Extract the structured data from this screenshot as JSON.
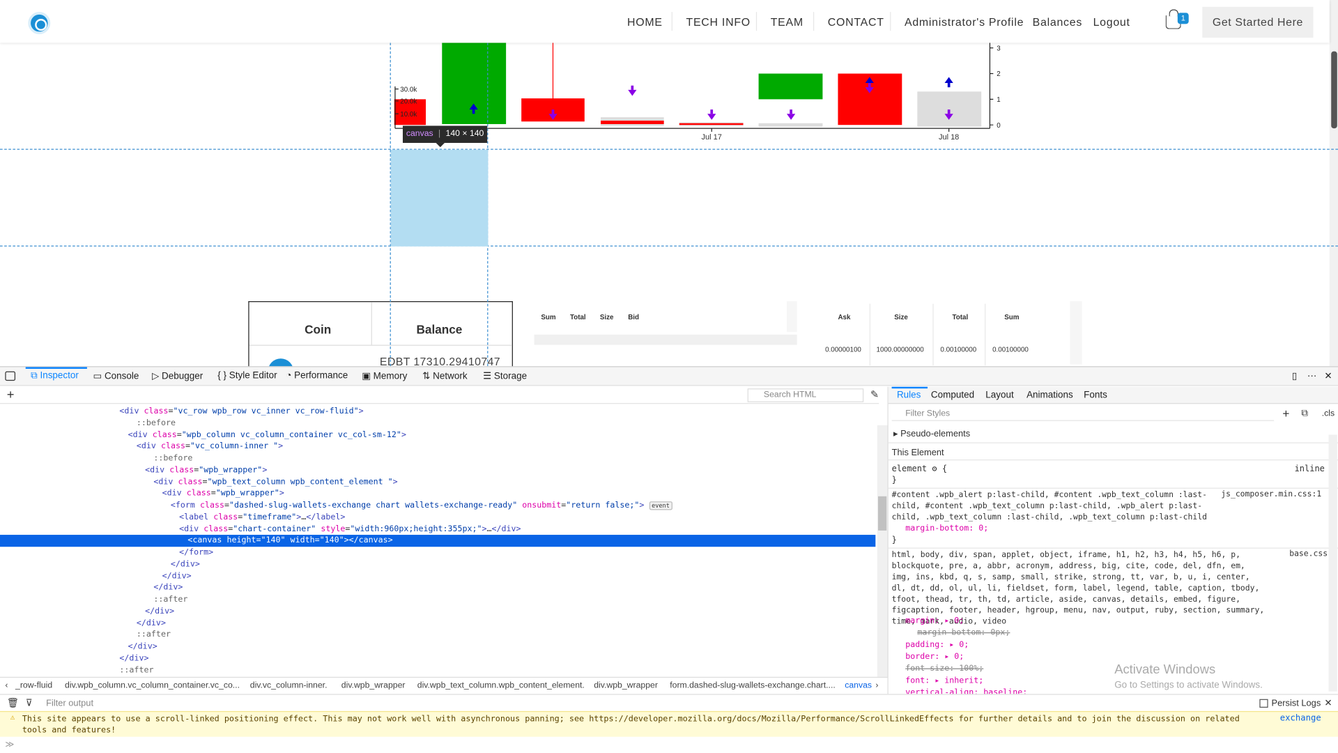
{
  "header": {
    "nav": [
      "HOME",
      "TECH INFO",
      "TEAM",
      "CONTACT",
      "Administrator's Profile",
      "Balances",
      "Logout"
    ],
    "cart_count": "1",
    "cta_label": "Get Started Here",
    "logo_icon": "coin-exchange-logo-icon"
  },
  "chart_data": {
    "type": "candlestick",
    "x_tick_labels": [
      "Jul 17",
      "Jul 18"
    ],
    "left_axis_ticks": [
      "30.0k",
      "20.0k",
      "10.0k"
    ],
    "right_axis_ticks": [
      "3",
      "2",
      "1",
      "0"
    ],
    "candles": [
      {
        "direction": "down",
        "color": "#ff0000"
      },
      {
        "direction": "up",
        "color": "#00aa00"
      },
      {
        "direction": "down",
        "color": "#ff0000"
      },
      {
        "direction": "down",
        "color": "#ff0000"
      },
      {
        "direction": "down",
        "color": "#ff0000"
      },
      {
        "direction": "up",
        "color": "#00aa00"
      },
      {
        "direction": "down",
        "color": "#ff0000"
      },
      {
        "direction": "flat",
        "color": "#dddddd"
      }
    ],
    "colors": {
      "up": "#00aa00",
      "down": "#ff0000",
      "volume": "#dddddd",
      "buy_marker": "#0000cc",
      "sell_marker": "#8a00e6"
    }
  },
  "inspector_tooltip": {
    "tag": "canvas",
    "size": "140 × 140"
  },
  "balances": {
    "headers": [
      "Coin",
      "Balance"
    ],
    "first_value": "EDBT 17310.29410747"
  },
  "orderbook": {
    "bid_headers": [
      "Sum",
      "Total",
      "Size",
      "Bid"
    ],
    "ask_headers": [
      "Ask",
      "Size",
      "Total",
      "Sum"
    ],
    "ask_row": [
      "0.00000100",
      "1000.00000000",
      "0.00100000",
      "0.00100000"
    ]
  },
  "devtools": {
    "tabs": [
      "Inspector",
      "Console",
      "Debugger",
      "Style Editor",
      "Performance",
      "Memory",
      "Network",
      "Storage"
    ],
    "search_placeholder": "Search HTML",
    "rules_tabs": [
      "Rules",
      "Computed",
      "Layout",
      "Animations",
      "Fonts"
    ],
    "filter_placeholder": "Filter Styles",
    "cls_label": ".cls",
    "pseudo_label": "Pseudo-elements",
    "this_element_label": "This Element",
    "element_rule": "element",
    "element_source": "inline",
    "rule1_selector": "#content .wpb_alert p:last-child, #content .wpb_text_column :last-child, #content .wpb_text_column p:last-child, .wpb_alert p:last-child, .wpb_text_column :last-child, .wpb_text_column p:last-child",
    "rule1_source": "js_composer.min.css:1",
    "rule1_decl": "margin-bottom: 0;",
    "rule2_selector": "html, body, div, span, applet, object, iframe, h1, h2, h3, h4, h5, h6, p, blockquote, pre, a, abbr, acronym, address, big, cite, code, del, dfn, em, img, ins, kbd, q, s, samp, small, strike, strong, tt, var, b, u, i, center, dl, dt, dd, ol, ul, li, fieldset, form, label, legend, table, caption, tbody, tfoot, thead, tr, th, td, article, aside, canvas, details, embed, figure, figcaption, footer, header, hgroup, menu, nav, output, ruby, section, summary, time, mark, audio, video",
    "rule2_source": "base.css:2",
    "rule2_decls": [
      "margin: ▸ 0;",
      "margin-bottom: 0px;",
      "padding: ▸ 0;",
      "border: ▸ 0;",
      "font-size: 100%;",
      "font: ▸ inherit;",
      "vertical-align: baseline;"
    ],
    "breadcrumbs": [
      "_row-fluid",
      "div.wpb_column.vc_column_container.vc_co...",
      "div.vc_column-inner.",
      "div.wpb_wrapper",
      "div.wpb_text_column.wpb_content_element.",
      "div.wpb_wrapper",
      "form.dashed-slug-wallets-exchange.chart....",
      "canvas"
    ],
    "console_filter_placeholder": "Filter output",
    "persist_logs": "Persist Logs",
    "warning_text": "This site appears to use a scroll-linked positioning effect. This may not work well with asynchronous panning; see https://developer.mozilla.org/docs/Mozilla/Performance/ScrollLinkedEffects for further details and to join the discussion on related tools and features!",
    "warning_source": "exchange",
    "activate_title": "Activate Windows",
    "activate_sub": "Go to Settings to activate Windows."
  },
  "html_tree": [
    {
      "indent": 14,
      "html": "<span class='tg'>&lt;div</span> <span class='an'>class</span>=<span class='av'>\"vc_row wpb_row vc_inner vc_row-fluid\"</span><span class='tg'>&gt;</span>"
    },
    {
      "indent": 16,
      "html": "<span class='ps'>::before</span>"
    },
    {
      "indent": 15,
      "html": "<span class='tg'>&lt;div</span> <span class='an'>class</span>=<span class='av'>\"wpb_column vc_column_container vc_col-sm-12\"</span><span class='tg'>&gt;</span>"
    },
    {
      "indent": 16,
      "html": "<span class='tg'>&lt;div</span> <span class='an'>class</span>=<span class='av'>\"vc_column-inner \"</span><span class='tg'>&gt;</span>"
    },
    {
      "indent": 18,
      "html": "<span class='ps'>::before</span>"
    },
    {
      "indent": 17,
      "html": "<span class='tg'>&lt;div</span> <span class='an'>class</span>=<span class='av'>\"wpb_wrapper\"</span><span class='tg'>&gt;</span>"
    },
    {
      "indent": 18,
      "html": "<span class='tg'>&lt;div</span> <span class='an'>class</span>=<span class='av'>\"wpb_text_column wpb_content_element \"</span><span class='tg'>&gt;</span>"
    },
    {
      "indent": 19,
      "html": "<span class='tg'>&lt;div</span> <span class='an'>class</span>=<span class='av'>\"wpb_wrapper\"</span><span class='tg'>&gt;</span>"
    },
    {
      "indent": 20,
      "html": "<span class='tg'>&lt;form</span> <span class='an'>class</span>=<span class='av'>\"dashed-slug-wallets-exchange chart wallets-exchange-ready\"</span> <span class='an'>onsubmit</span>=<span class='av'>\"return false;\"</span><span class='tg'>&gt;</span> <span class='evt'>event</span>"
    },
    {
      "indent": 21,
      "html": "<span class='tg'>&lt;label</span> <span class='an'>class</span>=<span class='av'>\"timeframe\"</span><span class='tg'>&gt;</span>…<span class='tg'>&lt;/label&gt;</span>"
    },
    {
      "indent": 21,
      "html": "<span class='tg'>&lt;div</span> <span class='an'>class</span>=<span class='av'>\"chart-container\"</span> <span class='an'>style</span>=<span class='av'>\"width:960px;height:355px;\"</span><span class='tg'>&gt;</span>…<span class='tg'>&lt;/div&gt;</span>"
    },
    {
      "indent": 22,
      "html": "<span class='tg'>&lt;canvas</span> <span class='an'>height</span>=<span class='av'>\"140\"</span> <span class='an'>width</span>=<span class='av'>\"140\"</span><span class='tg'>&gt;&lt;/canvas&gt;</span>",
      "selected": true
    },
    {
      "indent": 21,
      "html": "<span class='tg'>&lt;/form&gt;</span>"
    },
    {
      "indent": 20,
      "html": "<span class='tg'>&lt;/div&gt;</span>"
    },
    {
      "indent": 19,
      "html": "<span class='tg'>&lt;/div&gt;</span>"
    },
    {
      "indent": 18,
      "html": "<span class='tg'>&lt;/div&gt;</span>"
    },
    {
      "indent": 18,
      "html": "<span class='ps'>::after</span>"
    },
    {
      "indent": 17,
      "html": "<span class='tg'>&lt;/div&gt;</span>"
    },
    {
      "indent": 16,
      "html": "<span class='tg'>&lt;/div&gt;</span>"
    },
    {
      "indent": 16,
      "html": "<span class='ps'>::after</span>"
    },
    {
      "indent": 15,
      "html": "<span class='tg'>&lt;/div&gt;</span>"
    },
    {
      "indent": 14,
      "html": "<span class='tg'>&lt;/div&gt;</span>"
    },
    {
      "indent": 14,
      "html": "<span class='ps'>::after</span>"
    }
  ]
}
